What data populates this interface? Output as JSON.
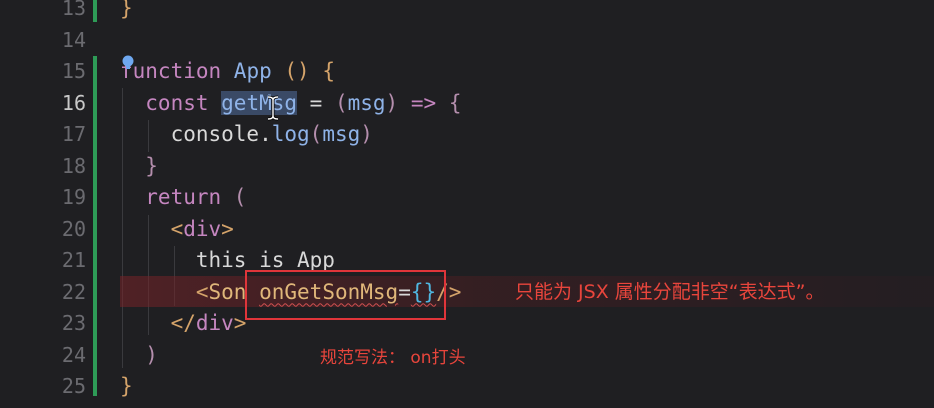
{
  "editor": {
    "lines": [
      {
        "n": "13",
        "parts": [
          {
            "c": "punc",
            "t": "}"
          }
        ]
      },
      {
        "n": "14",
        "parts": []
      },
      {
        "n": "15",
        "parts": [
          {
            "c": "kw",
            "t": "function "
          },
          {
            "c": "fn",
            "t": "App"
          },
          {
            "c": "txt",
            "t": " "
          },
          {
            "c": "punc",
            "t": "()"
          },
          {
            "c": "txt",
            "t": " "
          },
          {
            "c": "punc",
            "t": "{"
          }
        ]
      },
      {
        "n": "16",
        "active": true,
        "parts": [
          {
            "c": "kw",
            "t": "  const "
          },
          {
            "c": "var sel",
            "t": "getMsg"
          },
          {
            "c": "txt",
            "t": " = "
          },
          {
            "c": "kw2",
            "t": "("
          },
          {
            "c": "var",
            "t": "msg"
          },
          {
            "c": "kw2",
            "t": ")"
          },
          {
            "c": "txt",
            "t": " "
          },
          {
            "c": "kw",
            "t": "=>"
          },
          {
            "c": "txt",
            "t": " "
          },
          {
            "c": "kw2",
            "t": "{"
          }
        ]
      },
      {
        "n": "17",
        "parts": [
          {
            "c": "txt",
            "t": "    console."
          },
          {
            "c": "fn",
            "t": "log"
          },
          {
            "c": "kw2",
            "t": "("
          },
          {
            "c": "var",
            "t": "msg"
          },
          {
            "c": "kw2",
            "t": ")"
          }
        ]
      },
      {
        "n": "18",
        "parts": [
          {
            "c": "kw2",
            "t": "  }"
          }
        ]
      },
      {
        "n": "19",
        "parts": [
          {
            "c": "kw",
            "t": "  return "
          },
          {
            "c": "kw2",
            "t": "("
          }
        ]
      },
      {
        "n": "20",
        "parts": [
          {
            "c": "tag",
            "t": "    <"
          },
          {
            "c": "kw",
            "t": "div"
          },
          {
            "c": "tag",
            "t": ">"
          }
        ]
      },
      {
        "n": "21",
        "parts": [
          {
            "c": "txt",
            "t": "      this is App"
          }
        ]
      },
      {
        "n": "22",
        "parts": [
          {
            "c": "tag",
            "t": "      <"
          },
          {
            "c": "attr",
            "t": "Son"
          },
          {
            "c": "txt",
            "t": " "
          },
          {
            "c": "attr warn",
            "t": "onGetSonMsg"
          },
          {
            "c": "txt",
            "t": "="
          },
          {
            "c": "brace2 warn",
            "t": "{}"
          },
          {
            "c": "tag",
            "t": "/>"
          }
        ]
      },
      {
        "n": "23",
        "parts": [
          {
            "c": "tag",
            "t": "    </"
          },
          {
            "c": "kw",
            "t": "div"
          },
          {
            "c": "tag",
            "t": ">"
          }
        ]
      },
      {
        "n": "24",
        "parts": [
          {
            "c": "kw2",
            "t": "  )"
          }
        ]
      },
      {
        "n": "25",
        "parts": [
          {
            "c": "punc",
            "t": "}"
          }
        ]
      }
    ],
    "inline_error": "只能为 JSX 属性分配非空“表达式”。",
    "annotation": "规范写法： on打头"
  },
  "icons": {
    "lightbulb": "lightbulb-icon",
    "cursor": "text-cursor-icon"
  },
  "colors": {
    "background": "#1f1f22",
    "error_red": "#e8453c",
    "git_added": "#2e9b57"
  }
}
